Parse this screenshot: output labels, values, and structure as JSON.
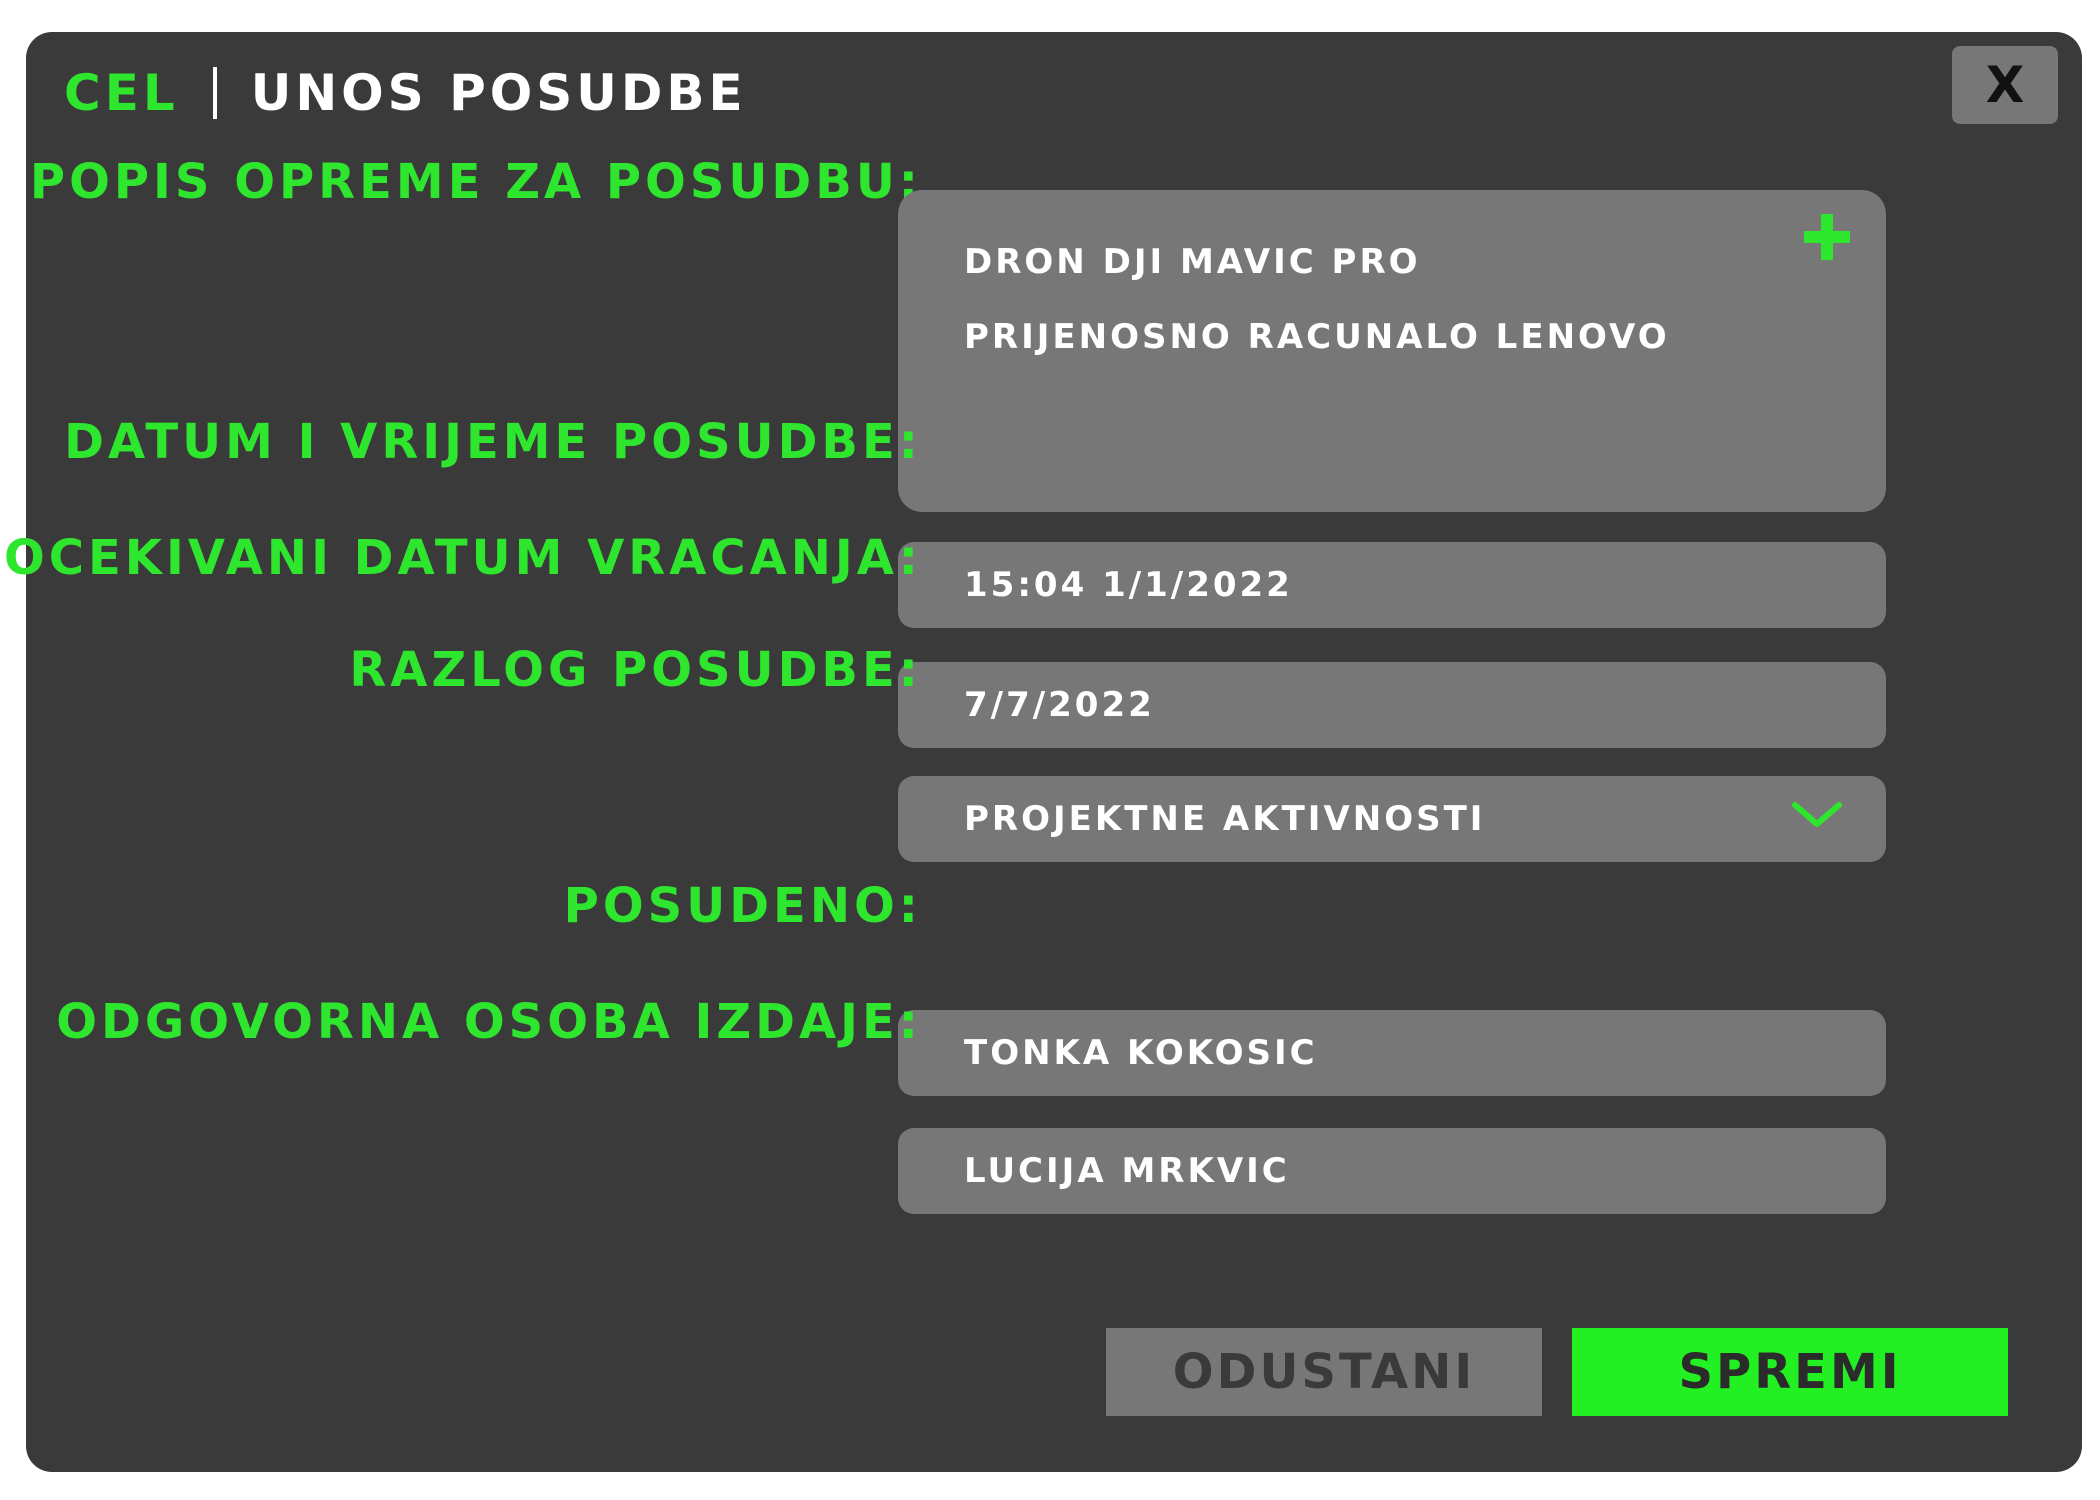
{
  "header": {
    "app_name": "CEL",
    "title": "UNOS POSUDBE",
    "close_label": "X"
  },
  "form": {
    "equipment": {
      "label": "POPIS OPREME ZA POSUDBU:",
      "items": [
        "DRON DJI MAVIC PRO",
        "PRIJENOSNO RACUNALO LENOVO"
      ],
      "add_icon": "plus-icon"
    },
    "loan_datetime": {
      "label": "DATUM I VRIJEME POSUDBE:",
      "value": "15:04 1/1/2022"
    },
    "return_date": {
      "label": "OCEKIVANI DATUM VRACANJA:",
      "value": "7/7/2022"
    },
    "reason": {
      "label": "RAZLOG POSUDBE:",
      "selected": "PROJEKTNE AKTIVNOSTI",
      "icon": "chevron-down-icon"
    },
    "borrowed_by": {
      "label": "POSUDENO:",
      "value": "TONKA KOKOSIC"
    },
    "issued_by": {
      "label": "ODGOVORNA OSOBA IZDAJE:",
      "value": "LUCIJA MRKVIC"
    }
  },
  "actions": {
    "cancel_label": "ODUSTANI",
    "save_label": "SPREMI"
  },
  "colors": {
    "accent": "#2ee62e",
    "save_button": "#22f022",
    "dialog_bg": "#3a3a3a",
    "field_bg": "#777777"
  }
}
